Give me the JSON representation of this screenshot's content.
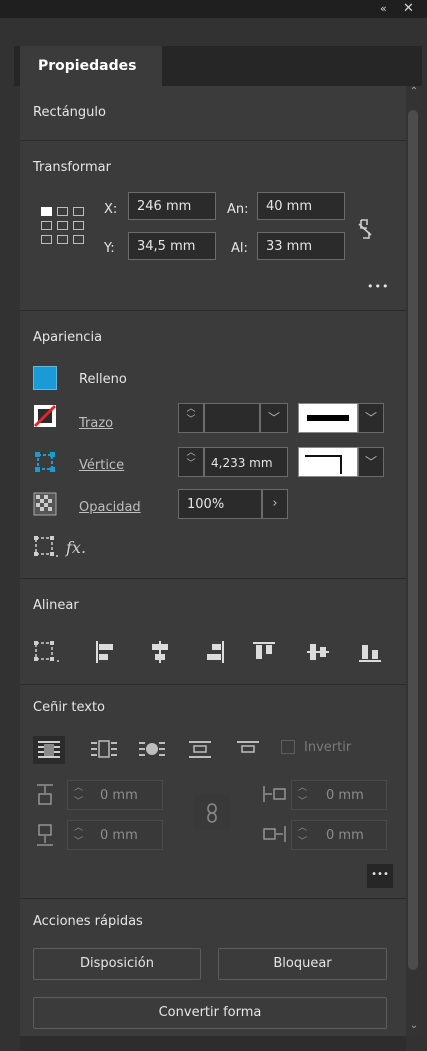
{
  "window": {
    "collapse_icon": "«",
    "close_icon": "✕"
  },
  "tab": {
    "label": "Propiedades"
  },
  "object_type": "Rectángulo",
  "transform": {
    "title": "Transformar",
    "x_label": "X:",
    "x_value": "246 mm",
    "y_label": "Y:",
    "y_value": "34,5 mm",
    "w_label": "An:",
    "w_value": "40 mm",
    "h_label": "Al:",
    "h_value": "33 mm",
    "more": "•••"
  },
  "appearance": {
    "title": "Apariencia",
    "fill_label": "Relleno",
    "fill_color": "#1a9ad6",
    "stroke_label": "Trazo",
    "corner_label": "Vértice",
    "corner_value": "4,233 mm",
    "opacity_label": "Opacidad",
    "opacity_value": "100%",
    "fx_label": "fx."
  },
  "align": {
    "title": "Alinear"
  },
  "wrap": {
    "title": "Ceñir texto",
    "invert_label": "Invertir",
    "top_value": "0 mm",
    "bottom_value": "0 mm",
    "left_value": "0 mm",
    "right_value": "0 mm",
    "more": "•••"
  },
  "quick_actions": {
    "title": "Acciones rápidas",
    "layout_button": "Disposición",
    "lock_button": "Bloquear",
    "convert_button": "Convertir forma"
  }
}
